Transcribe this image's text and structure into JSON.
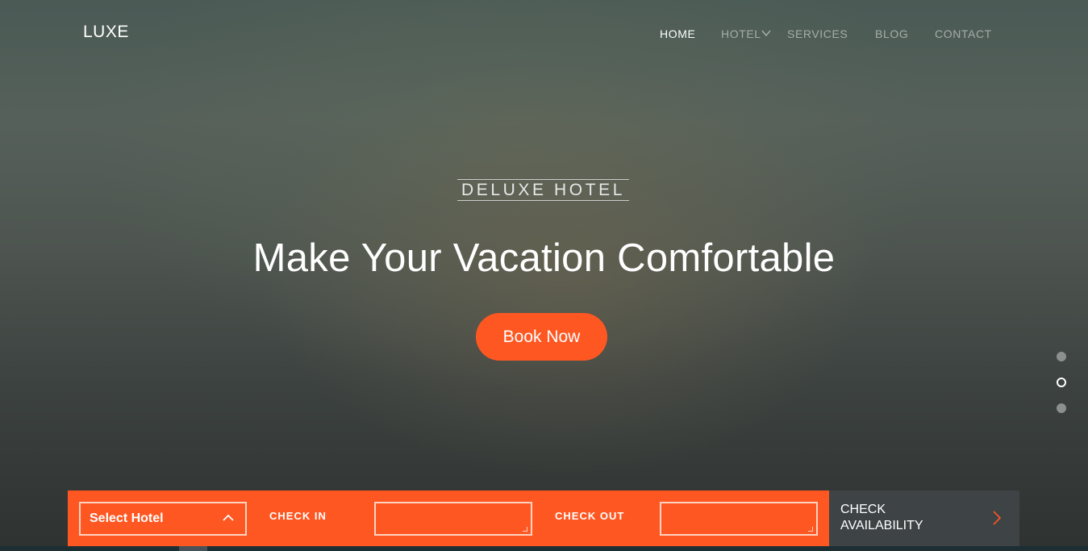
{
  "brand": {
    "logo": "LUXE"
  },
  "nav": {
    "items": [
      {
        "label": "HOME",
        "active": true
      },
      {
        "label": "HOTEL",
        "has_dropdown": true
      },
      {
        "label": "SERVICES"
      },
      {
        "label": "BLOG"
      },
      {
        "label": "CONTACT"
      }
    ]
  },
  "hero": {
    "kicker": "DELUXE HOTEL",
    "headline": "Make Your Vacation Comfortable",
    "cta_label": "Book Now",
    "slides": {
      "count": 3,
      "active_index": 1
    }
  },
  "booking": {
    "select_hotel_label": "Select Hotel",
    "check_in_label": "CHECK IN",
    "check_in_value": "",
    "check_out_label": "CHECK OUT",
    "check_out_value": "",
    "submit_line1": "CHECK",
    "submit_line2": "AVAILABILITY"
  },
  "icons": {
    "hotel_dropdown": "chevron-down-icon",
    "select": "chevron-up-icon",
    "submit": "chevron-right-icon"
  },
  "colors": {
    "accent": "#ff5722",
    "submit_bg": "#3e4346",
    "nav_active": "#ffffff",
    "nav_inactive": "#a6acaa"
  }
}
